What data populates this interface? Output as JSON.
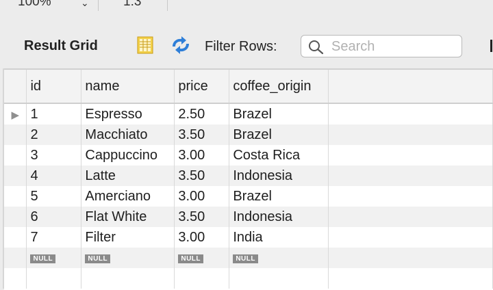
{
  "top": {
    "zoom_value": "100%",
    "ratio_value": "1:3"
  },
  "toolbar": {
    "title": "Result Grid",
    "filter_label": "Filter Rows:",
    "search_placeholder": "Search",
    "search_value": ""
  },
  "grid": {
    "columns": [
      "id",
      "name",
      "price",
      "coffee_origin"
    ],
    "rows": [
      {
        "id": "1",
        "name": "Espresso",
        "price": "2.50",
        "coffee_origin": "Brazel"
      },
      {
        "id": "2",
        "name": "Macchiato",
        "price": "3.50",
        "coffee_origin": "Brazel"
      },
      {
        "id": "3",
        "name": "Cappuccino",
        "price": "3.00",
        "coffee_origin": "Costa Rica"
      },
      {
        "id": "4",
        "name": "Latte",
        "price": "3.50",
        "coffee_origin": "Indonesia"
      },
      {
        "id": "5",
        "name": "Amerciano",
        "price": "3.00",
        "coffee_origin": "Brazel"
      },
      {
        "id": "6",
        "name": "Flat White",
        "price": "3.50",
        "coffee_origin": "Indonesia"
      },
      {
        "id": "7",
        "name": "Filter",
        "price": "3.00",
        "coffee_origin": "India"
      }
    ],
    "null_label": "NULL",
    "current_row_marker": "▶"
  },
  "colors": {
    "toolbar_bg": "#ececec",
    "row_alt": "#f1f1f1",
    "null_badge": "#8a8a8a",
    "refresh_blue": "#2f7fd8"
  }
}
